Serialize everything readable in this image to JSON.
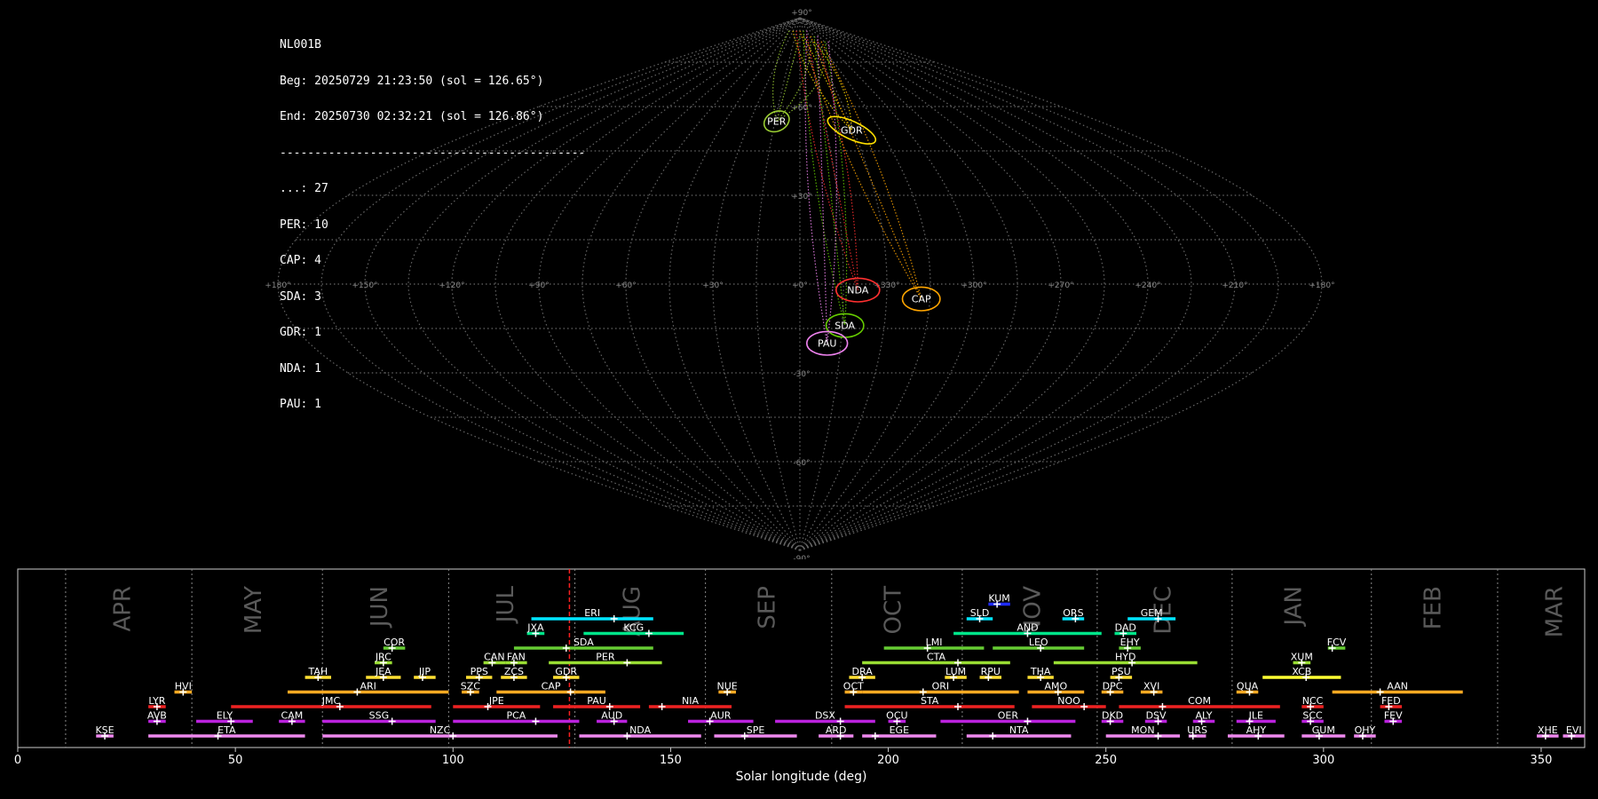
{
  "header": {
    "station": "NL001B",
    "begin": "Beg: 20250729 21:23:50 (sol = 126.65°)",
    "end": "End: 20250730 02:32:21 (sol = 126.86°)",
    "divider": "--------------------------------------------",
    "counts": [
      {
        "label": "...: 27"
      },
      {
        "label": "PER: 10"
      },
      {
        "label": "CAP: 4"
      },
      {
        "label": "SDA: 3"
      },
      {
        "label": "GDR: 1"
      },
      {
        "label": "NDA: 1"
      },
      {
        "label": "PAU: 1"
      }
    ]
  },
  "chart_data": [
    {
      "type": "scatter",
      "projection": "sinusoidal",
      "lat_ticks": [
        {
          "value": 90,
          "label": "+90°"
        },
        {
          "value": 60,
          "label": "+60°"
        },
        {
          "value": 30,
          "label": "+30°"
        },
        {
          "value": -30,
          "label": "-30°"
        },
        {
          "value": -60,
          "label": "-60°"
        },
        {
          "value": -90,
          "label": "-90°"
        }
      ],
      "lon_ticks": [
        {
          "value": -180,
          "label": "+180°"
        },
        {
          "value": -150,
          "label": "+150°"
        },
        {
          "value": -120,
          "label": "+120°"
        },
        {
          "value": -90,
          "label": "+90°"
        },
        {
          "value": -60,
          "label": "+60°"
        },
        {
          "value": -30,
          "label": "+30°"
        },
        {
          "value": 0,
          "label": "+0°"
        },
        {
          "value": 30,
          "label": "+330°"
        },
        {
          "value": 60,
          "label": "+300°"
        },
        {
          "value": 90,
          "label": "+270°"
        },
        {
          "value": 120,
          "label": "+240°"
        },
        {
          "value": 150,
          "label": "+210°"
        },
        {
          "value": 180,
          "label": "+180°"
        }
      ],
      "radiants": [
        {
          "name": "PER",
          "lon": -14,
          "lat": 55,
          "rx": 4.5,
          "ry": 3.3,
          "color": "#9ACD32"
        },
        {
          "name": "GDR",
          "lon": 29,
          "lat": 52,
          "rx": 9,
          "ry": 3.0,
          "color": "#FFE000"
        },
        {
          "name": "NDA",
          "lon": 20,
          "lat": -2,
          "rx": 7.5,
          "ry": 4.0,
          "color": "#FF3030"
        },
        {
          "name": "CAP",
          "lon": 42,
          "lat": -5,
          "rx": 6.5,
          "ry": 4.0,
          "color": "#FFA500"
        },
        {
          "name": "SDA",
          "lon": 16,
          "lat": -14,
          "rx": 6.5,
          "ry": 4.0,
          "color": "#66CC00"
        },
        {
          "name": "PAU",
          "lon": 10,
          "lat": -20,
          "rx": 7.0,
          "ry": 4.0,
          "color": "#EE82EE"
        }
      ]
    },
    {
      "type": "bar",
      "xlabel": "Solar longitude (deg)",
      "xlim": [
        0,
        360
      ],
      "xticks": [
        0,
        50,
        100,
        150,
        200,
        250,
        300,
        350
      ],
      "current_sol": 126.75,
      "months": [
        {
          "name": "APR",
          "center": 24
        },
        {
          "name": "MAY",
          "center": 54
        },
        {
          "name": "JUN",
          "center": 83
        },
        {
          "name": "JUL",
          "center": 112
        },
        {
          "name": "AUG",
          "center": 141
        },
        {
          "name": "SEP",
          "center": 172
        },
        {
          "name": "OCT",
          "center": 201
        },
        {
          "name": "NOV",
          "center": 233
        },
        {
          "name": "DEC",
          "center": 263
        },
        {
          "name": "JAN",
          "center": 293
        },
        {
          "name": "FEB",
          "center": 325
        },
        {
          "name": "MAR",
          "center": 353
        }
      ],
      "month_boundaries": [
        11,
        40,
        70,
        99,
        128,
        158,
        187,
        217,
        248,
        279,
        311,
        340
      ],
      "showers": [
        {
          "code": "KUM",
          "start": 223,
          "end": 228,
          "peak": 225,
          "row": 10,
          "color": "#1E2BFF"
        },
        {
          "code": "ERI",
          "start": 118,
          "end": 146,
          "peak": 137,
          "row": 9,
          "color": "#00E5FF"
        },
        {
          "code": "SLD",
          "start": 218,
          "end": 224,
          "peak": 221,
          "row": 9,
          "color": "#00E5FF"
        },
        {
          "code": "ORS",
          "start": 240,
          "end": 245,
          "peak": 243,
          "row": 9,
          "color": "#00E5FF"
        },
        {
          "code": "GEM",
          "start": 255,
          "end": 266,
          "peak": 262,
          "row": 9,
          "color": "#00E5FF"
        },
        {
          "code": "JXA",
          "start": 117,
          "end": 121,
          "peak": 119,
          "row": 8,
          "color": "#00E68A"
        },
        {
          "code": "KCG",
          "start": 130,
          "end": 153,
          "peak": 145,
          "row": 8,
          "color": "#00E68A"
        },
        {
          "code": "AND",
          "start": 215,
          "end": 249,
          "peak": 232,
          "row": 8,
          "color": "#00E68A"
        },
        {
          "code": "DAD",
          "start": 252,
          "end": 257,
          "peak": 254,
          "row": 8,
          "color": "#00E68A"
        },
        {
          "code": "COR",
          "start": 84,
          "end": 89,
          "peak": 86,
          "row": 7,
          "color": "#66CC33"
        },
        {
          "code": "SDA",
          "start": 114,
          "end": 146,
          "peak": 126,
          "row": 7,
          "color": "#66CC33"
        },
        {
          "code": "LMI",
          "start": 199,
          "end": 222,
          "peak": 209,
          "row": 7,
          "color": "#66CC33"
        },
        {
          "code": "LEO",
          "start": 224,
          "end": 245,
          "peak": 235,
          "row": 7,
          "color": "#66CC33"
        },
        {
          "code": "EHY",
          "start": 253,
          "end": 258,
          "peak": 255,
          "row": 7,
          "color": "#66CC33"
        },
        {
          "code": "FCV",
          "start": 301,
          "end": 305,
          "peak": 302,
          "row": 7,
          "color": "#66CC33"
        },
        {
          "code": "JRC",
          "start": 82,
          "end": 86,
          "peak": 84,
          "row": 6,
          "color": "#99DD33"
        },
        {
          "code": "CAN",
          "start": 107,
          "end": 112,
          "peak": 109,
          "row": 6,
          "color": "#99DD33"
        },
        {
          "code": "FAN",
          "start": 112,
          "end": 117,
          "peak": 114,
          "row": 6,
          "color": "#99DD33"
        },
        {
          "code": "PER",
          "start": 122,
          "end": 148,
          "peak": 140,
          "row": 6,
          "color": "#99DD33"
        },
        {
          "code": "CTA",
          "start": 194,
          "end": 228,
          "peak": 216,
          "row": 6,
          "color": "#99DD33"
        },
        {
          "code": "HYD",
          "start": 238,
          "end": 271,
          "peak": 256,
          "row": 6,
          "color": "#99DD33"
        },
        {
          "code": "XUM",
          "start": 293,
          "end": 297,
          "peak": 295,
          "row": 6,
          "color": "#99DD33"
        },
        {
          "code": "TAH",
          "start": 66,
          "end": 72,
          "peak": 69,
          "row": 5,
          "color": "#FFE033"
        },
        {
          "code": "JEA",
          "start": 80,
          "end": 88,
          "peak": 84,
          "row": 5,
          "color": "#FFE033"
        },
        {
          "code": "JIP",
          "start": 91,
          "end": 96,
          "peak": 93,
          "row": 5,
          "color": "#FFE033"
        },
        {
          "code": "PPS",
          "start": 103,
          "end": 109,
          "peak": 106,
          "row": 5,
          "color": "#FFE033"
        },
        {
          "code": "ZCS",
          "start": 111,
          "end": 117,
          "peak": 114,
          "row": 5,
          "color": "#FFE033"
        },
        {
          "code": "GDR",
          "start": 123,
          "end": 129,
          "peak": 126,
          "row": 5,
          "color": "#FFE033"
        },
        {
          "code": "DRA",
          "start": 191,
          "end": 197,
          "peak": 194,
          "row": 5,
          "color": "#FFE033"
        },
        {
          "code": "LUM",
          "start": 213,
          "end": 218,
          "peak": 215,
          "row": 5,
          "color": "#FFE033"
        },
        {
          "code": "RPU",
          "start": 221,
          "end": 226,
          "peak": 223,
          "row": 5,
          "color": "#FFE033"
        },
        {
          "code": "THA",
          "start": 232,
          "end": 238,
          "peak": 235,
          "row": 5,
          "color": "#FFE033"
        },
        {
          "code": "PSU",
          "start": 251,
          "end": 256,
          "peak": 253,
          "row": 5,
          "color": "#FFE033"
        },
        {
          "code": "XCB",
          "start": 286,
          "end": 304,
          "peak": 296,
          "row": 5,
          "color": "#FFFF33"
        },
        {
          "code": "HVI",
          "start": 36,
          "end": 40,
          "peak": 38,
          "row": 4,
          "color": "#FFAA22"
        },
        {
          "code": "ARI",
          "start": 62,
          "end": 99,
          "peak": 78,
          "row": 4,
          "color": "#FFAA22"
        },
        {
          "code": "SZC",
          "start": 102,
          "end": 106,
          "peak": 104,
          "row": 4,
          "color": "#FFAA22"
        },
        {
          "code": "CAP",
          "start": 110,
          "end": 135,
          "peak": 127,
          "row": 4,
          "color": "#FFAA22"
        },
        {
          "code": "NUE",
          "start": 161,
          "end": 165,
          "peak": 163,
          "row": 4,
          "color": "#FFAA22"
        },
        {
          "code": "OCT",
          "start": 190,
          "end": 194,
          "peak": 192,
          "row": 4,
          "color": "#FFAA22"
        },
        {
          "code": "ORI",
          "start": 194,
          "end": 230,
          "peak": 208,
          "row": 4,
          "color": "#FFAA22"
        },
        {
          "code": "AMO",
          "start": 232,
          "end": 245,
          "peak": 239,
          "row": 4,
          "color": "#FFAA22"
        },
        {
          "code": "DPC",
          "start": 249,
          "end": 254,
          "peak": 251,
          "row": 4,
          "color": "#FFAA22"
        },
        {
          "code": "XVI",
          "start": 258,
          "end": 263,
          "peak": 261,
          "row": 4,
          "color": "#FFAA22"
        },
        {
          "code": "QUA",
          "start": 280,
          "end": 285,
          "peak": 283,
          "row": 4,
          "color": "#FFAA22"
        },
        {
          "code": "AAN",
          "start": 302,
          "end": 332,
          "peak": 313,
          "row": 4,
          "color": "#FFAA22"
        },
        {
          "code": "LYR",
          "start": 30,
          "end": 34,
          "peak": 32,
          "row": 3,
          "color": "#EE2222"
        },
        {
          "code": "JMC",
          "start": 49,
          "end": 95,
          "peak": 74,
          "row": 3,
          "color": "#EE2222"
        },
        {
          "code": "JPE",
          "start": 100,
          "end": 120,
          "peak": 108,
          "row": 3,
          "color": "#EE2222"
        },
        {
          "code": "PAU",
          "start": 123,
          "end": 143,
          "peak": 136,
          "row": 3,
          "color": "#EE2222"
        },
        {
          "code": "NIA",
          "start": 145,
          "end": 164,
          "peak": 148,
          "row": 3,
          "color": "#EE2222"
        },
        {
          "code": "STA",
          "start": 190,
          "end": 229,
          "peak": 216,
          "row": 3,
          "color": "#EE2222"
        },
        {
          "code": "NOO",
          "start": 233,
          "end": 250,
          "peak": 245,
          "row": 3,
          "color": "#EE2222"
        },
        {
          "code": "COM",
          "start": 253,
          "end": 290,
          "peak": 263,
          "row": 3,
          "color": "#EE2222"
        },
        {
          "code": "NCC",
          "start": 295,
          "end": 300,
          "peak": 297,
          "row": 3,
          "color": "#EE2222"
        },
        {
          "code": "FED",
          "start": 313,
          "end": 318,
          "peak": 315,
          "row": 3,
          "color": "#EE2222"
        },
        {
          "code": "AVB",
          "start": 30,
          "end": 34,
          "peak": 32,
          "row": 2,
          "color": "#BB22DD"
        },
        {
          "code": "ELY",
          "start": 41,
          "end": 54,
          "peak": 49,
          "row": 2,
          "color": "#BB22DD"
        },
        {
          "code": "CAM",
          "start": 60,
          "end": 66,
          "peak": 63,
          "row": 2,
          "color": "#BB22DD"
        },
        {
          "code": "SSG",
          "start": 70,
          "end": 96,
          "peak": 86,
          "row": 2,
          "color": "#BB22DD"
        },
        {
          "code": "PCA",
          "start": 100,
          "end": 129,
          "peak": 119,
          "row": 2,
          "color": "#BB22DD"
        },
        {
          "code": "AUD",
          "start": 133,
          "end": 140,
          "peak": 137,
          "row": 2,
          "color": "#BB22DD"
        },
        {
          "code": "AUR",
          "start": 154,
          "end": 169,
          "peak": 159,
          "row": 2,
          "color": "#BB22DD"
        },
        {
          "code": "DSX",
          "start": 174,
          "end": 197,
          "peak": 189,
          "row": 2,
          "color": "#BB22DD"
        },
        {
          "code": "OCU",
          "start": 200,
          "end": 204,
          "peak": 202,
          "row": 2,
          "color": "#BB22DD"
        },
        {
          "code": "OER",
          "start": 212,
          "end": 243,
          "peak": 232,
          "row": 2,
          "color": "#BB22DD"
        },
        {
          "code": "DKD",
          "start": 249,
          "end": 254,
          "peak": 251,
          "row": 2,
          "color": "#BB22DD"
        },
        {
          "code": "DSV",
          "start": 259,
          "end": 264,
          "peak": 262,
          "row": 2,
          "color": "#BB22DD"
        },
        {
          "code": "ALY",
          "start": 270,
          "end": 275,
          "peak": 272,
          "row": 2,
          "color": "#BB22DD"
        },
        {
          "code": "JLE",
          "start": 280,
          "end": 289,
          "peak": 283,
          "row": 2,
          "color": "#BB22DD"
        },
        {
          "code": "SCC",
          "start": 295,
          "end": 300,
          "peak": 297,
          "row": 2,
          "color": "#BB22DD"
        },
        {
          "code": "FEV",
          "start": 314,
          "end": 318,
          "peak": 316,
          "row": 2,
          "color": "#BB22DD"
        },
        {
          "code": "KSE",
          "start": 18,
          "end": 22,
          "peak": 20,
          "row": 1,
          "color": "#EE88EE"
        },
        {
          "code": "ETA",
          "start": 30,
          "end": 66,
          "peak": 46,
          "row": 1,
          "color": "#EE88EE"
        },
        {
          "code": "NZC",
          "start": 70,
          "end": 124,
          "peak": 100,
          "row": 1,
          "color": "#EE88EE"
        },
        {
          "code": "NDA",
          "start": 129,
          "end": 157,
          "peak": 140,
          "row": 1,
          "color": "#EE88EE"
        },
        {
          "code": "SPE",
          "start": 160,
          "end": 179,
          "peak": 167,
          "row": 1,
          "color": "#EE88EE"
        },
        {
          "code": "ARD",
          "start": 184,
          "end": 192,
          "peak": 189,
          "row": 1,
          "color": "#EE88EE"
        },
        {
          "code": "EGE",
          "start": 194,
          "end": 211,
          "peak": 197,
          "row": 1,
          "color": "#EE88EE"
        },
        {
          "code": "NTA",
          "start": 218,
          "end": 242,
          "peak": 224,
          "row": 1,
          "color": "#EE88EE"
        },
        {
          "code": "MON",
          "start": 250,
          "end": 267,
          "peak": 262,
          "row": 1,
          "color": "#EE88EE"
        },
        {
          "code": "URS",
          "start": 269,
          "end": 273,
          "peak": 270,
          "row": 1,
          "color": "#EE88EE"
        },
        {
          "code": "AHY",
          "start": 278,
          "end": 291,
          "peak": 285,
          "row": 1,
          "color": "#EE88EE"
        },
        {
          "code": "GUM",
          "start": 295,
          "end": 305,
          "peak": 299,
          "row": 1,
          "color": "#EE88EE"
        },
        {
          "code": "OHY",
          "start": 307,
          "end": 312,
          "peak": 309,
          "row": 1,
          "color": "#EE88EE"
        },
        {
          "code": "XHE",
          "start": 349,
          "end": 354,
          "peak": 351,
          "row": 1,
          "color": "#EE88EE"
        },
        {
          "code": "EVI",
          "start": 355,
          "end": 360,
          "peak": 357,
          "row": 1,
          "color": "#EE88EE"
        }
      ]
    }
  ]
}
